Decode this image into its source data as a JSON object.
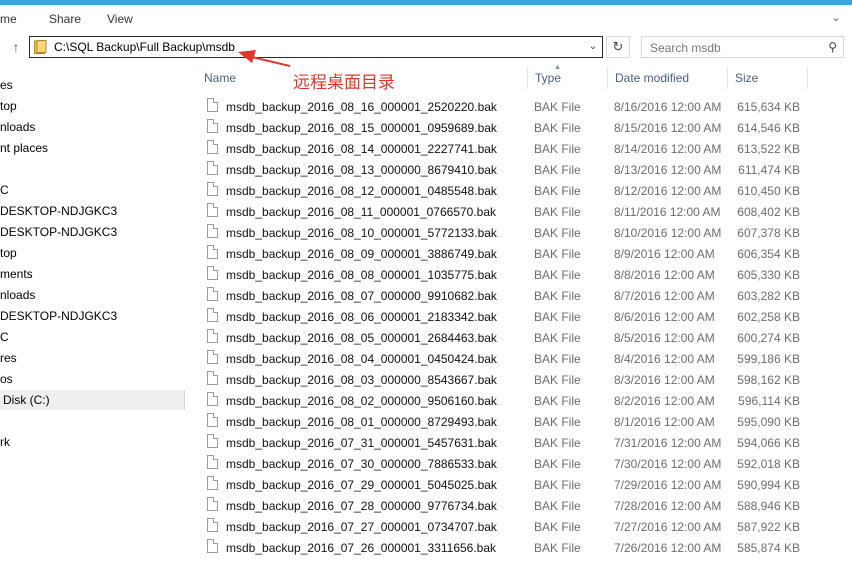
{
  "ribbon": {
    "tabs": [
      "me",
      "Share",
      "View"
    ]
  },
  "address": {
    "path": "C:\\SQL Backup\\Full Backup\\msdb"
  },
  "search": {
    "placeholder": "Search msdb"
  },
  "annotation": "远程桌面目录",
  "nav": [
    "es",
    "top",
    "nloads",
    "nt places",
    "",
    "C",
    "DESKTOP-NDJGKC3",
    "DESKTOP-NDJGKC3",
    "top",
    "ments",
    "nloads",
    "DESKTOP-NDJGKC3",
    "C",
    "res",
    "os",
    "Disk (C:)",
    "",
    "rk"
  ],
  "nav_selected": 15,
  "columns": {
    "name": "Name",
    "type": "Type",
    "date": "Date modified",
    "size": "Size"
  },
  "files": [
    {
      "name": "msdb_backup_2016_08_16_000001_2520220.bak",
      "type": "BAK File",
      "date": "8/16/2016 12:00 AM",
      "size": "615,634 KB"
    },
    {
      "name": "msdb_backup_2016_08_15_000001_0959689.bak",
      "type": "BAK File",
      "date": "8/15/2016 12:00 AM",
      "size": "614,546 KB"
    },
    {
      "name": "msdb_backup_2016_08_14_000001_2227741.bak",
      "type": "BAK File",
      "date": "8/14/2016 12:00 AM",
      "size": "613,522 KB"
    },
    {
      "name": "msdb_backup_2016_08_13_000000_8679410.bak",
      "type": "BAK File",
      "date": "8/13/2016 12:00 AM",
      "size": "611,474 KB"
    },
    {
      "name": "msdb_backup_2016_08_12_000001_0485548.bak",
      "type": "BAK File",
      "date": "8/12/2016 12:00 AM",
      "size": "610,450 KB"
    },
    {
      "name": "msdb_backup_2016_08_11_000001_0766570.bak",
      "type": "BAK File",
      "date": "8/11/2016 12:00 AM",
      "size": "608,402 KB"
    },
    {
      "name": "msdb_backup_2016_08_10_000001_5772133.bak",
      "type": "BAK File",
      "date": "8/10/2016 12:00 AM",
      "size": "607,378 KB"
    },
    {
      "name": "msdb_backup_2016_08_09_000001_3886749.bak",
      "type": "BAK File",
      "date": "8/9/2016 12:00 AM",
      "size": "606,354 KB"
    },
    {
      "name": "msdb_backup_2016_08_08_000001_1035775.bak",
      "type": "BAK File",
      "date": "8/8/2016 12:00 AM",
      "size": "605,330 KB"
    },
    {
      "name": "msdb_backup_2016_08_07_000000_9910682.bak",
      "type": "BAK File",
      "date": "8/7/2016 12:00 AM",
      "size": "603,282 KB"
    },
    {
      "name": "msdb_backup_2016_08_06_000001_2183342.bak",
      "type": "BAK File",
      "date": "8/6/2016 12:00 AM",
      "size": "602,258 KB"
    },
    {
      "name": "msdb_backup_2016_08_05_000001_2684463.bak",
      "type": "BAK File",
      "date": "8/5/2016 12:00 AM",
      "size": "600,274 KB"
    },
    {
      "name": "msdb_backup_2016_08_04_000001_0450424.bak",
      "type": "BAK File",
      "date": "8/4/2016 12:00 AM",
      "size": "599,186 KB"
    },
    {
      "name": "msdb_backup_2016_08_03_000000_8543667.bak",
      "type": "BAK File",
      "date": "8/3/2016 12:00 AM",
      "size": "598,162 KB"
    },
    {
      "name": "msdb_backup_2016_08_02_000000_9506160.bak",
      "type": "BAK File",
      "date": "8/2/2016 12:00 AM",
      "size": "596,114 KB"
    },
    {
      "name": "msdb_backup_2016_08_01_000000_8729493.bak",
      "type": "BAK File",
      "date": "8/1/2016 12:00 AM",
      "size": "595,090 KB"
    },
    {
      "name": "msdb_backup_2016_07_31_000001_5457631.bak",
      "type": "BAK File",
      "date": "7/31/2016 12:00 AM",
      "size": "594,066 KB"
    },
    {
      "name": "msdb_backup_2016_07_30_000000_7886533.bak",
      "type": "BAK File",
      "date": "7/30/2016 12:00 AM",
      "size": "592,018 KB"
    },
    {
      "name": "msdb_backup_2016_07_29_000001_5045025.bak",
      "type": "BAK File",
      "date": "7/29/2016 12:00 AM",
      "size": "590,994 KB"
    },
    {
      "name": "msdb_backup_2016_07_28_000000_9776734.bak",
      "type": "BAK File",
      "date": "7/28/2016 12:00 AM",
      "size": "588,946 KB"
    },
    {
      "name": "msdb_backup_2016_07_27_000001_0734707.bak",
      "type": "BAK File",
      "date": "7/27/2016 12:00 AM",
      "size": "587,922 KB"
    },
    {
      "name": "msdb_backup_2016_07_26_000001_3311656.bak",
      "type": "BAK File",
      "date": "7/26/2016 12:00 AM",
      "size": "585,874 KB"
    }
  ]
}
